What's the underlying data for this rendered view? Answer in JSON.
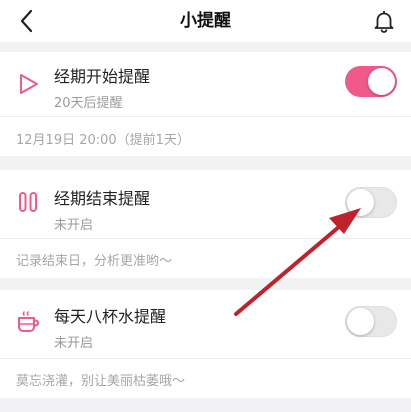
{
  "header": {
    "title": "小提醒"
  },
  "reminders": [
    {
      "title": "经期开始提醒",
      "status": "20天后提醒",
      "note": "12月19日 20:00（提前1天）",
      "enabled": true,
      "icon": "play-triangle-icon"
    },
    {
      "title": "经期结束提醒",
      "status": "未开启",
      "note": "记录结束日，分析更准哟～",
      "enabled": false,
      "icon": "pause-icon"
    },
    {
      "title": "每天八杯水提醒",
      "status": "未开启",
      "note": "莫忘浇灌，别让美丽枯萎哦～",
      "enabled": false,
      "icon": "cup-icon"
    }
  ],
  "colors": {
    "accent": "#f05a8a",
    "background": "#f2f2f4",
    "annotation_arrow": "#c0212a"
  }
}
